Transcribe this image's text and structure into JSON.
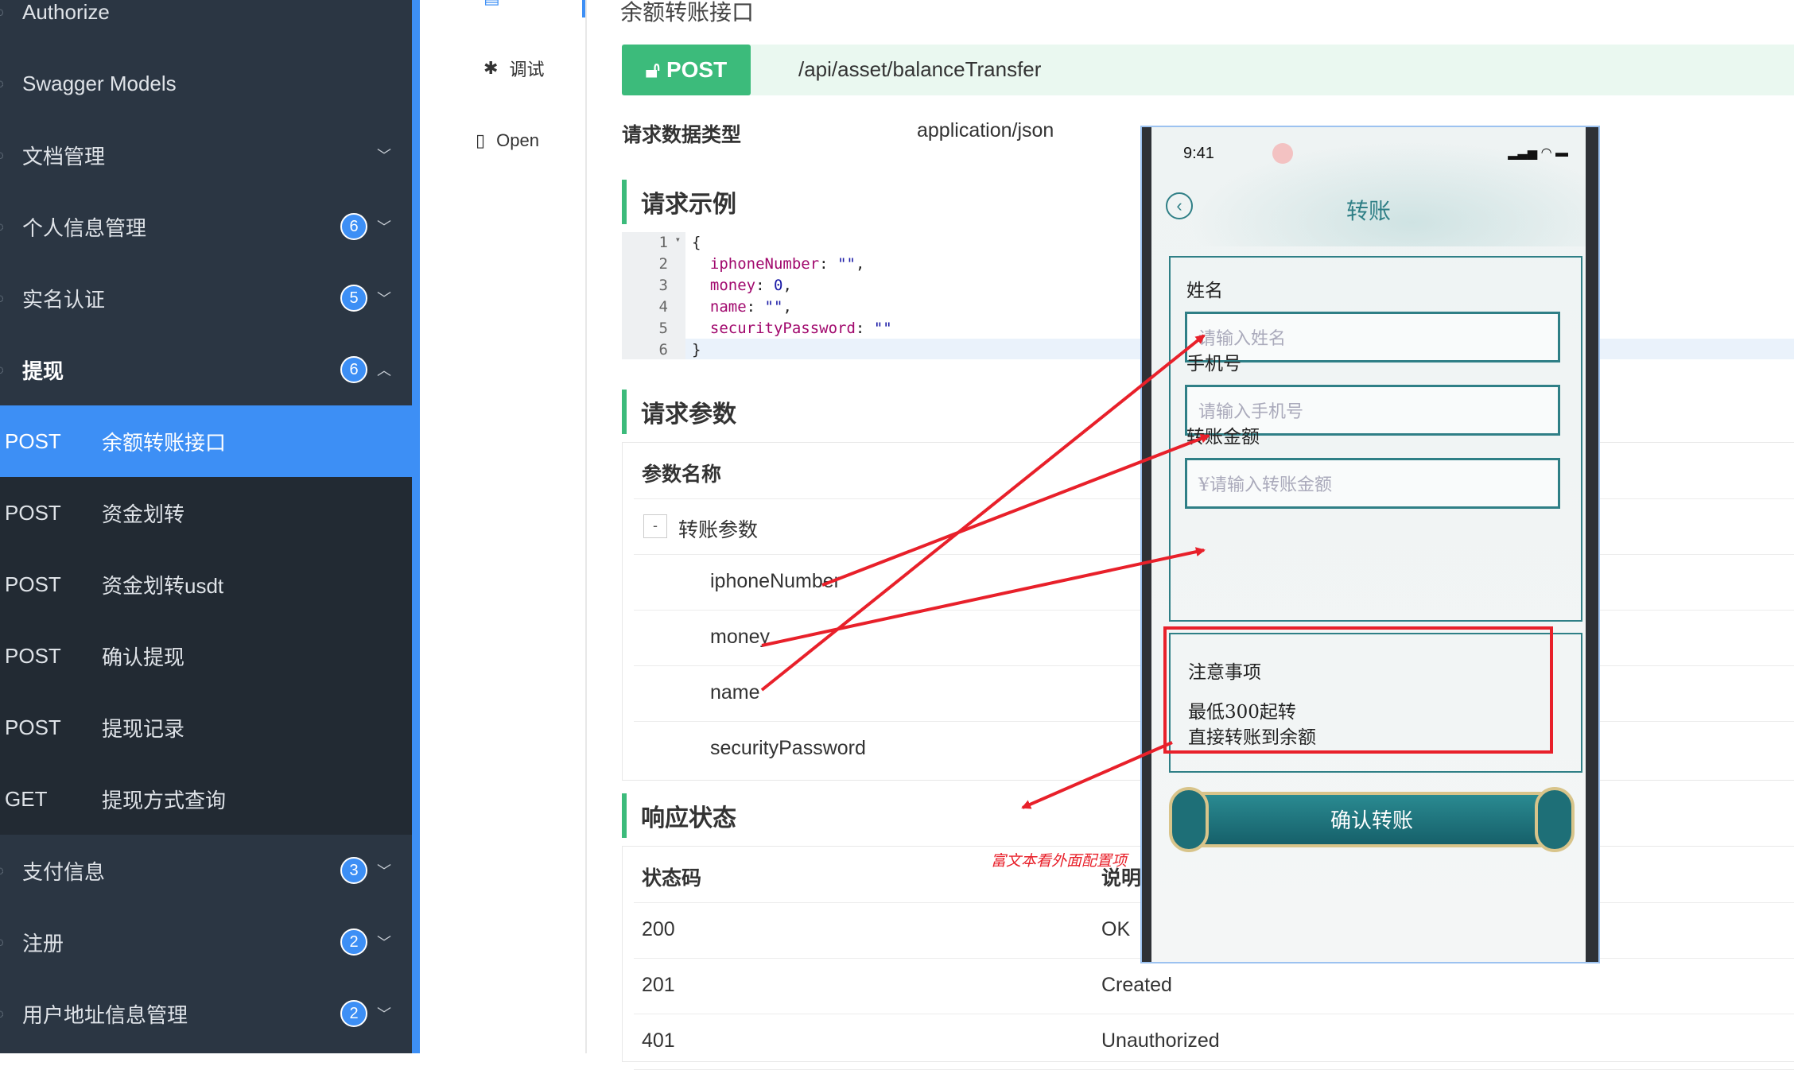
{
  "sidebar": {
    "top_items": [
      {
        "label": "Authorize"
      },
      {
        "label": "Swagger Models"
      }
    ],
    "groups": [
      {
        "label": "文档管理",
        "badge": ""
      },
      {
        "label": "个人信息管理",
        "badge": "6"
      },
      {
        "label": "实名认证",
        "badge": "5"
      },
      {
        "label": "提现",
        "badge": "6"
      }
    ],
    "sub_items": [
      {
        "method": "POST",
        "label": "余额转账接口"
      },
      {
        "method": "POST",
        "label": "资金划转"
      },
      {
        "method": "POST",
        "label": "资金划转usdt"
      },
      {
        "method": "POST",
        "label": "确认提现"
      },
      {
        "method": "POST",
        "label": "提现记录"
      },
      {
        "method": "GET",
        "label": "提现方式查询"
      }
    ],
    "bottom_groups": [
      {
        "label": "支付信息",
        "badge": "3"
      },
      {
        "label": "注册",
        "badge": "2"
      },
      {
        "label": "用户地址信息管理",
        "badge": "2"
      }
    ]
  },
  "tabs": {
    "debug": "调试",
    "open": "Open"
  },
  "doc": {
    "title": "余额转账接口",
    "method": "POST",
    "url": "/api/asset/balanceTransfer",
    "request_type_label": "请求数据类型",
    "request_type_value": "application/json",
    "example_heading": "请求示例",
    "params_heading": "请求参数",
    "response_heading": "响应状态",
    "param_name_header": "参数名称",
    "param_group": "转账参数",
    "params": [
      "iphoneNumber",
      "money",
      "name",
      "securityPassword"
    ],
    "status_headers": {
      "code": "状态码",
      "desc": "说明"
    },
    "status_rows": [
      {
        "code": "200",
        "desc": "OK"
      },
      {
        "code": "201",
        "desc": "Created"
      },
      {
        "code": "401",
        "desc": "Unauthorized"
      }
    ],
    "code_lines": [
      "1",
      "2",
      "3",
      "4",
      "5",
      "6"
    ]
  },
  "phone": {
    "time": "9:41",
    "title": "转账",
    "fields": [
      {
        "label": "姓名",
        "placeholder": "请输入姓名"
      },
      {
        "label": "手机号",
        "placeholder": "请输入手机号"
      },
      {
        "label": "转账金额",
        "placeholder": "¥请输入转账金额"
      }
    ],
    "note_title": "注意事项",
    "note_lines": [
      "最低300起转",
      "直接转账到余额"
    ],
    "confirm_label": "确认转账"
  },
  "annotation": {
    "rich_text": "富文本看外面配置项"
  },
  "colors": {
    "sidebar_bg": "#2b3643",
    "accent_blue": "#3d8ff5",
    "post_green": "#3cbb7b",
    "teal": "#2f7f86",
    "annotation_red": "#e8202a"
  }
}
